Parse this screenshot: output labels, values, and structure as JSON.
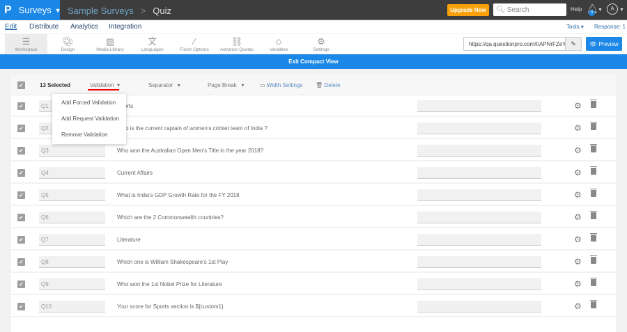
{
  "topbar": {
    "logo": "P",
    "product": "Surveys",
    "breadcrumb": [
      "Sample Surveys",
      "Quiz"
    ],
    "upgrade": "Upgrade Now",
    "search_placeholder": "Search",
    "help": "Help",
    "notifications": "3",
    "avatar": "A"
  },
  "menu": {
    "items": [
      "Edit",
      "Distribute",
      "Analytics",
      "Integration"
    ],
    "tools": "Tools",
    "response": "Response: 1"
  },
  "toolbar": {
    "items": [
      "Workspace",
      "Design",
      "Media Library",
      "Languages",
      "Finish Options",
      "Advance Quotas",
      "Variables",
      "Settings"
    ],
    "url": "https://qa.questionpro.com/t/APNrFZeY",
    "preview": "Preview"
  },
  "exit_compact": "Exit Compact View",
  "bulk": {
    "selected": "13 Selected",
    "validation": "Validation",
    "separator": "Separator",
    "page_break": "Page Break",
    "width_settings": "Width Settings",
    "delete": "Delete"
  },
  "validation_menu": [
    "Add Forced Validation",
    "Add Request Validation",
    "Remove Validation"
  ],
  "questions": [
    {
      "code": "Q1",
      "text": "Sports"
    },
    {
      "code": "Q2",
      "text": "Who is the current captain of women's cricket team of India ?"
    },
    {
      "code": "Q3",
      "text": "Who won the Australian Open Men's Title in the year 2018?"
    },
    {
      "code": "Q4",
      "text": "Current Affairs"
    },
    {
      "code": "Q5",
      "text": "What is India's GDP Growth Rate for the FY 2018"
    },
    {
      "code": "Q6",
      "text": "Which are the 2 Commonwealth countries?"
    },
    {
      "code": "Q7",
      "text": "Literature"
    },
    {
      "code": "Q8",
      "text": "Which one is William Shakespeare's 1st Play"
    },
    {
      "code": "Q9",
      "text": "Who won the 1st Nobel Prize for Literature"
    },
    {
      "code": "Q10",
      "text": "Your score for Sports section is ${custom1}"
    }
  ],
  "colors": {
    "brand": "#1b87e6",
    "upgrade": "#f8a10a",
    "topbar": "#3d3d3d"
  }
}
